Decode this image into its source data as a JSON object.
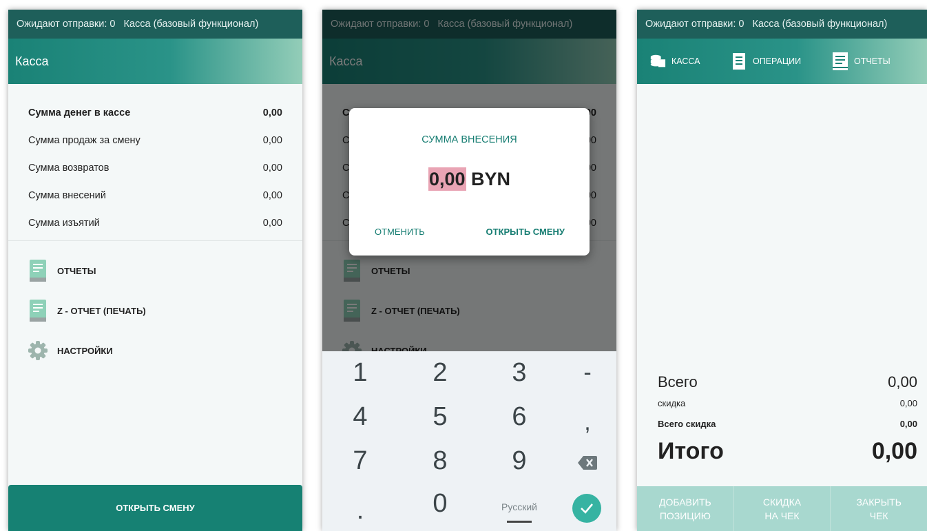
{
  "status_bar": {
    "pending": "Ожидают отправки: 0",
    "mode": "Касса (базовый функционал)"
  },
  "screen1": {
    "title": "Касса",
    "rows": [
      {
        "label": "Сумма денег в кассе",
        "value": "0,00"
      },
      {
        "label": "Сумма продаж за смену",
        "value": "0,00"
      },
      {
        "label": "Сумма возвратов",
        "value": "0,00"
      },
      {
        "label": "Сумма внесений",
        "value": "0,00"
      },
      {
        "label": "Сумма изъятий",
        "value": "0,00"
      }
    ],
    "menu": [
      {
        "label": "ОТЧЕТЫ",
        "icon": "report-icon"
      },
      {
        "label": "Z - ОТЧЕТ (ПЕЧАТЬ)",
        "icon": "report-icon"
      },
      {
        "label": "НАСТРОЙКИ",
        "icon": "gear-icon"
      }
    ],
    "open_shift": "ОТКРЫТЬ СМЕНУ"
  },
  "screen2": {
    "dialog": {
      "title": "СУММА ВНЕСЕНИЯ",
      "amount": "0,00",
      "currency": "BYN",
      "cancel": "ОТМЕНИТЬ",
      "confirm": "ОТКРЫТЬ СМЕНУ"
    },
    "keypad": {
      "keys": [
        "1",
        "2",
        "3",
        "-",
        "4",
        "5",
        "6",
        ",",
        "7",
        "8",
        "9",
        "0",
        "."
      ],
      "language": "Русский"
    }
  },
  "screen3": {
    "tabs": [
      {
        "label": "КАССА",
        "icon": "cash-icon"
      },
      {
        "label": "ОПЕРАЦИИ",
        "icon": "receipt-icon"
      },
      {
        "label": "ОТЧЕТЫ",
        "icon": "report-icon"
      }
    ],
    "totals": {
      "total_label": "Всего",
      "total_value": "0,00",
      "discount_label": "скидка",
      "discount_value": "0,00",
      "total_discount_label": "Всего скидка",
      "total_discount_value": "0,00",
      "grand_label": "Итого",
      "grand_value": "0,00"
    },
    "actions": [
      {
        "line1": "ДОБАВИТЬ",
        "line2": "ПОЗИЦИЮ"
      },
      {
        "line1": "СКИДКА",
        "line2": "НА ЧЕК"
      },
      {
        "line1": "ЗАКРЫТЬ",
        "line2": "ЧЕК"
      }
    ]
  },
  "colors": {
    "primary": "#168173",
    "status_bar": "#1e5f5a",
    "accent": "#36b3a2",
    "highlight": "#e9a4b4"
  }
}
